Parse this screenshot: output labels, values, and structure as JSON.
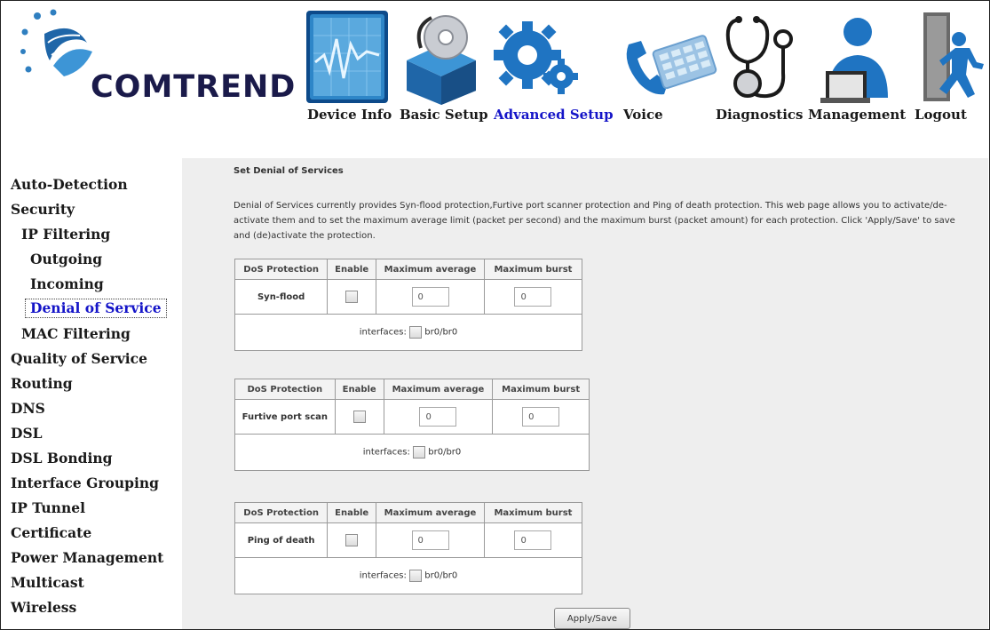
{
  "brand": {
    "name": "COMTREND"
  },
  "nav": {
    "items": [
      {
        "label": "Device Info",
        "icon": "chart-monitor-icon",
        "active": false
      },
      {
        "label": "Basic Setup",
        "icon": "box-disc-icon",
        "active": false
      },
      {
        "label": "Advanced Setup",
        "icon": "gears-icon",
        "active": true
      },
      {
        "label": "Voice",
        "icon": "phone-icon",
        "active": false
      },
      {
        "label": "Diagnostics",
        "icon": "stethoscope-icon",
        "active": false
      },
      {
        "label": "Management",
        "icon": "person-laptop-icon",
        "active": false
      },
      {
        "label": "Logout",
        "icon": "exit-door-icon",
        "active": false
      }
    ]
  },
  "sidebar": {
    "items": [
      {
        "label": "Auto-Detection",
        "level": 0
      },
      {
        "label": "Security",
        "level": 0
      },
      {
        "label": "IP Filtering",
        "level": 1
      },
      {
        "label": "Outgoing",
        "level": 2
      },
      {
        "label": "Incoming",
        "level": 2
      },
      {
        "label": "Denial of Service",
        "level": 2,
        "active": true
      },
      {
        "label": "MAC Filtering",
        "level": 1
      },
      {
        "label": "Quality of Service",
        "level": 0
      },
      {
        "label": "Routing",
        "level": 0
      },
      {
        "label": "DNS",
        "level": 0
      },
      {
        "label": "DSL",
        "level": 0
      },
      {
        "label": "DSL Bonding",
        "level": 0
      },
      {
        "label": "Interface Grouping",
        "level": 0
      },
      {
        "label": "IP Tunnel",
        "level": 0
      },
      {
        "label": "Certificate",
        "level": 0
      },
      {
        "label": "Power Management",
        "level": 0
      },
      {
        "label": "Multicast",
        "level": 0
      },
      {
        "label": "Wireless",
        "level": 0
      }
    ]
  },
  "main": {
    "title": "Set Denial of Services",
    "description": "Denial of Services currently provides Syn-flood protection,Furtive port scanner protection and Ping of death protection. This web page allows you to activate/de-activate them and to set the maximum average limit (packet per second) and the maximum burst (packet amount) for each protection. Click 'Apply/Save' to save and (de)activate the protection.",
    "headers": [
      "DoS Protection",
      "Enable",
      "Maximum average",
      "Maximum burst"
    ],
    "protections": [
      {
        "name": "Syn-flood",
        "enabled": false,
        "max_average": "0",
        "max_burst": "0",
        "interfaces_label": "interfaces:",
        "interface": "br0/br0",
        "interface_checked": false
      },
      {
        "name": "Furtive port scan",
        "enabled": false,
        "max_average": "0",
        "max_burst": "0",
        "interfaces_label": "interfaces:",
        "interface": "br0/br0",
        "interface_checked": false
      },
      {
        "name": "Ping of death",
        "enabled": false,
        "max_average": "0",
        "max_burst": "0",
        "interfaces_label": "interfaces:",
        "interface": "br0/br0",
        "interface_checked": false
      }
    ],
    "apply_label": "Apply/Save"
  },
  "colors": {
    "active_link": "#1515c8",
    "main_bg": "#eeeeee"
  }
}
